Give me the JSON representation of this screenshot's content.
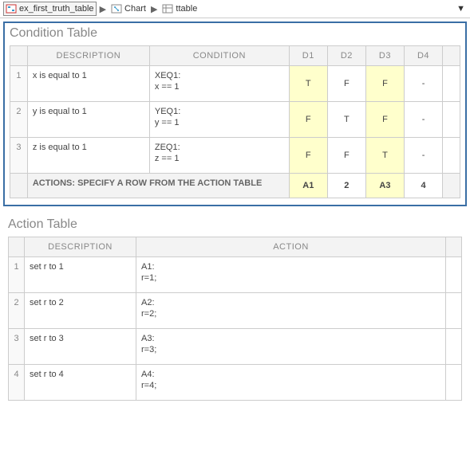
{
  "breadcrumb": {
    "item1": "ex_first_truth_table",
    "item2": "Chart",
    "item3": "ttable"
  },
  "conditionTable": {
    "title": "Condition Table",
    "headers": {
      "desc": "DESCRIPTION",
      "cond": "CONDITION",
      "d1": "D1",
      "d2": "D2",
      "d3": "D3",
      "d4": "D4"
    },
    "rows": [
      {
        "num": "1",
        "desc": "x is equal to 1",
        "cond1": "XEQ1:",
        "cond2": "x == 1",
        "d1": "T",
        "d2": "F",
        "d3": "F",
        "d4": "-"
      },
      {
        "num": "2",
        "desc": "y is equal to 1",
        "cond1": "YEQ1:",
        "cond2": "y == 1",
        "d1": "F",
        "d2": "T",
        "d3": "F",
        "d4": "-"
      },
      {
        "num": "3",
        "desc": "z is equal to 1",
        "cond1": "ZEQ1:",
        "cond2": "z == 1",
        "d1": "F",
        "d2": "F",
        "d3": "T",
        "d4": "-"
      }
    ],
    "actionsRow": {
      "label": "ACTIONS: SPECIFY A ROW FROM THE ACTION TABLE",
      "d1": "A1",
      "d2": "2",
      "d3": "A3",
      "d4": "4"
    }
  },
  "actionTable": {
    "title": "Action Table",
    "headers": {
      "desc": "DESCRIPTION",
      "act": "ACTION"
    },
    "rows": [
      {
        "num": "1",
        "desc": "set r to 1",
        "act1": "A1:",
        "act2": "r=1;"
      },
      {
        "num": "2",
        "desc": "set r to 2",
        "act1": "A2:",
        "act2": "r=2;"
      },
      {
        "num": "3",
        "desc": "set r to 3",
        "act1": "A3:",
        "act2": "r=3;"
      },
      {
        "num": "4",
        "desc": "set r to 4",
        "act1": "A4:",
        "act2": "r=4;"
      }
    ]
  }
}
